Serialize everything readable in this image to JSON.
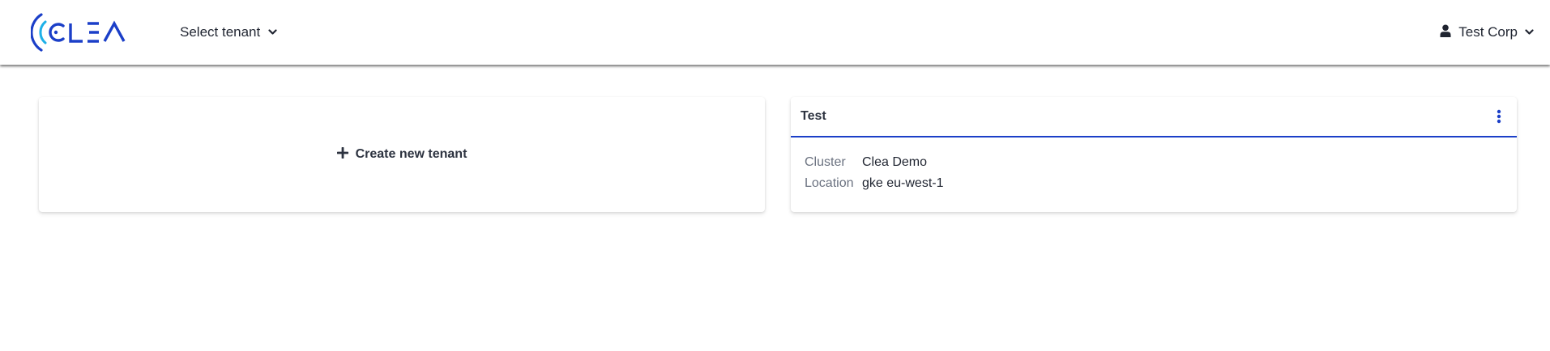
{
  "header": {
    "logo": {
      "brand": "CLEA",
      "colors": {
        "primary": "#1b3fc8",
        "accent": "#1eb0e8"
      }
    },
    "tenant_select": {
      "label": "Select tenant",
      "icon": "chevron-down-icon"
    },
    "user_menu": {
      "label": "Test Corp",
      "icon": "user-icon",
      "caret": "chevron-down-icon"
    }
  },
  "create_card": {
    "label": "Create new tenant",
    "icon": "plus-icon"
  },
  "tenants": [
    {
      "name": "Test",
      "menu_icon": "kebab-menu-icon",
      "fields": [
        {
          "label": "Cluster",
          "value": "Clea Demo"
        },
        {
          "label": "Location",
          "value": "gke eu-west-1"
        }
      ]
    }
  ],
  "colors": {
    "accent": "#1b3fc8",
    "text": "#1f2430",
    "muted": "#6b7280"
  }
}
